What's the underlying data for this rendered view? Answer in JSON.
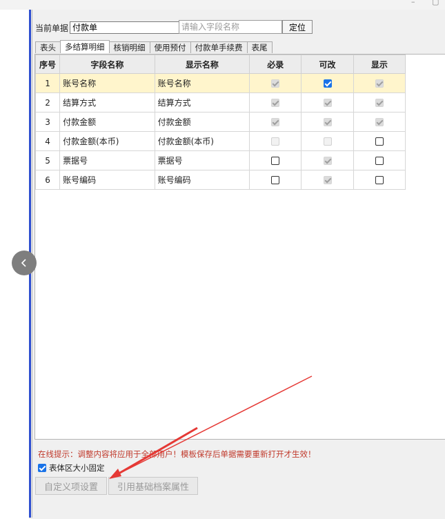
{
  "window": {
    "minimize_glyph": "–",
    "maximize_glyph": "▢"
  },
  "doc": {
    "label": "当前单据",
    "value": "付款单"
  },
  "search": {
    "placeholder": "请输入字段名称"
  },
  "locate_label": "定位",
  "tabs": [
    {
      "label": "表头",
      "active": false
    },
    {
      "label": "多结算明细",
      "active": true
    },
    {
      "label": "核销明细",
      "active": false
    },
    {
      "label": "使用预付",
      "active": false
    },
    {
      "label": "付款单手续费",
      "active": false
    },
    {
      "label": "表尾",
      "active": false
    }
  ],
  "table": {
    "headers": [
      "序号",
      "字段名称",
      "显示名称",
      "必录",
      "可改",
      "显示"
    ],
    "rows": [
      {
        "seq": "1",
        "field": "账号名称",
        "display": "账号名称",
        "required": "dis-checked",
        "editable": "checked",
        "visible": "dis-checked",
        "selected": true
      },
      {
        "seq": "2",
        "field": "结算方式",
        "display": "结算方式",
        "required": "dis-checked",
        "editable": "dis-checked",
        "visible": "dis-checked",
        "selected": false
      },
      {
        "seq": "3",
        "field": "付款金额",
        "display": "付款金额",
        "required": "dis-checked",
        "editable": "dis-checked",
        "visible": "dis-checked",
        "selected": false
      },
      {
        "seq": "4",
        "field": "付款金额(本币)",
        "display": "付款金额(本币)",
        "required": "dis",
        "editable": "dis",
        "visible": "unchecked",
        "selected": false
      },
      {
        "seq": "5",
        "field": "票据号",
        "display": "票据号",
        "required": "unchecked",
        "editable": "dis-checked",
        "visible": "unchecked",
        "selected": false
      },
      {
        "seq": "6",
        "field": "账号编码",
        "display": "账号编码",
        "required": "unchecked",
        "editable": "dis-checked",
        "visible": "unchecked",
        "selected": false
      }
    ]
  },
  "hint": "在线提示：调整内容将应用于全部用户！模板保存后单据需要重新打开才生效！",
  "fixed_size": {
    "label": "表体区大小固定",
    "checked": true
  },
  "buttons": {
    "custom": "自定义项设置",
    "reference": "引用基础档案属性"
  },
  "colors": {
    "accent": "#1a73e8",
    "hint": "#c0392b",
    "selected_row": "#fff5cc",
    "annotation_arrow": "#e53935",
    "rail_line": "#2f4fd0"
  },
  "icons": {
    "collapse": "chevron-left-icon",
    "annotation": "red-arrow-icon"
  }
}
